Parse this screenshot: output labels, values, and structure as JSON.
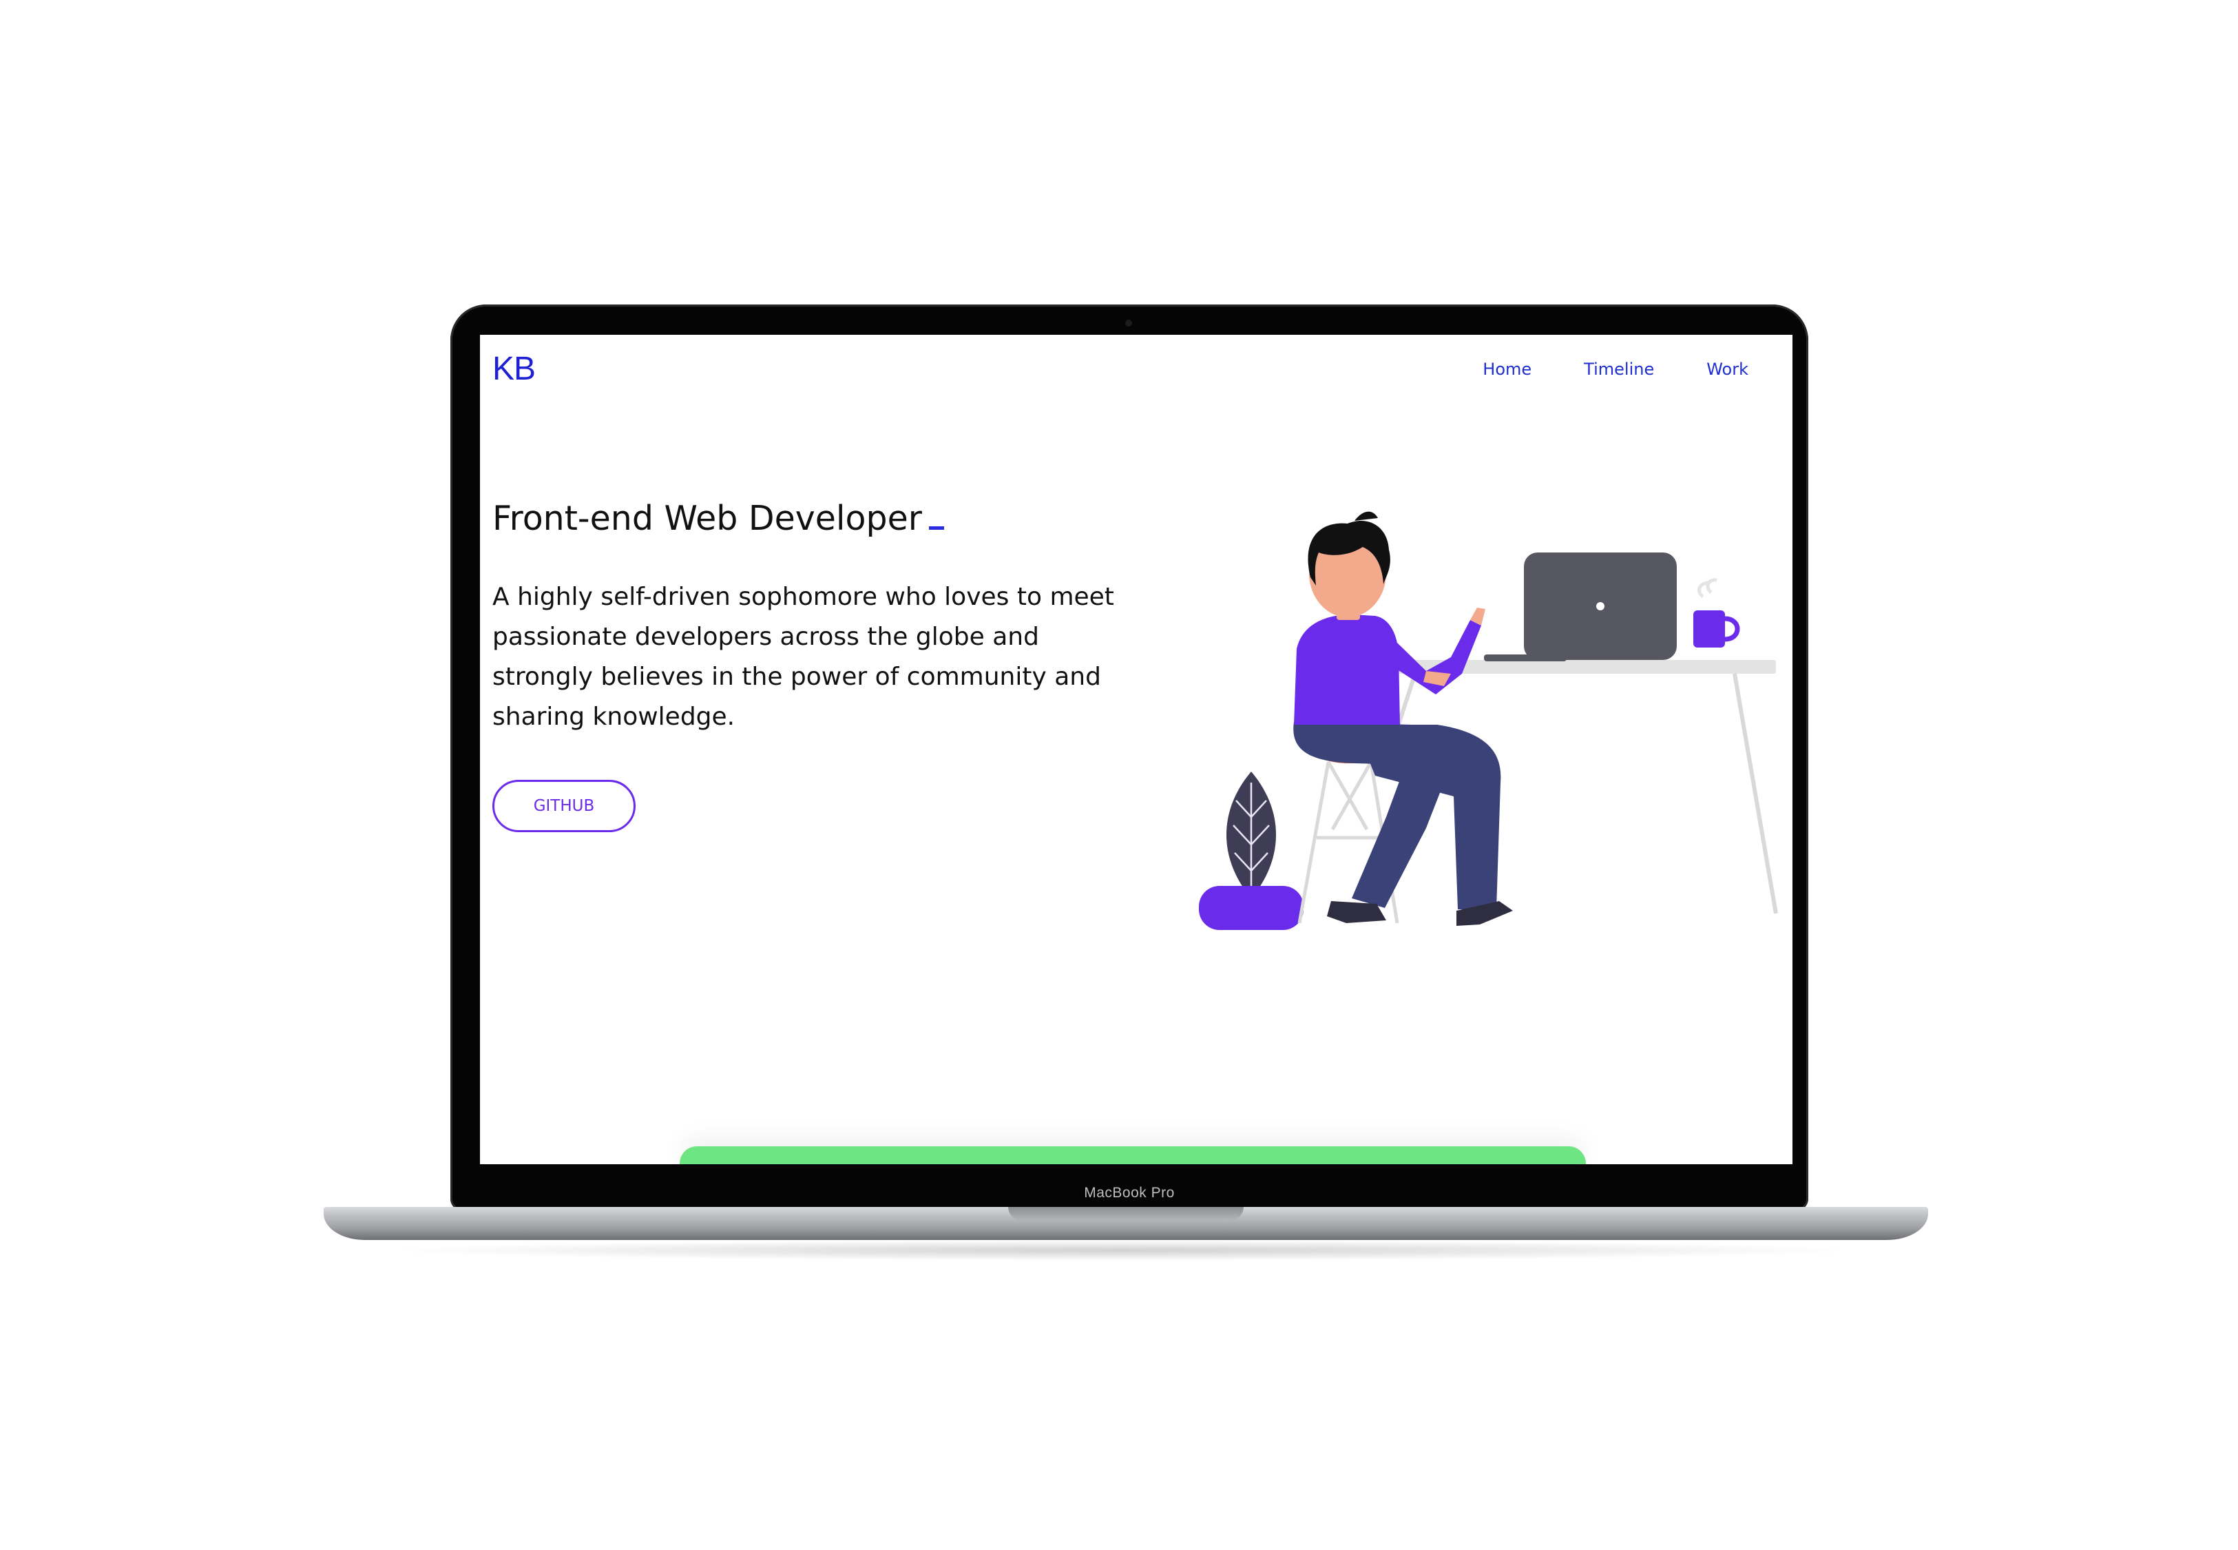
{
  "device": {
    "label": "MacBook Pro"
  },
  "header": {
    "logo": "KB",
    "nav": [
      {
        "label": "Home"
      },
      {
        "label": "Timeline"
      },
      {
        "label": "Work"
      }
    ]
  },
  "hero": {
    "title": "Front-end Web Developer",
    "description": "A highly self-driven sophomore who loves to meet passionate developers across the globe and strongly believes in the power of community and sharing knowledge.",
    "button_label": "GITHUB"
  },
  "colors": {
    "accent": "#6b2bea",
    "nav_link": "#1f2fcf",
    "logo": "#1f1fd6",
    "next_section": "#6de582"
  },
  "illustration": {
    "icon": "developer-at-desk-illustration"
  }
}
